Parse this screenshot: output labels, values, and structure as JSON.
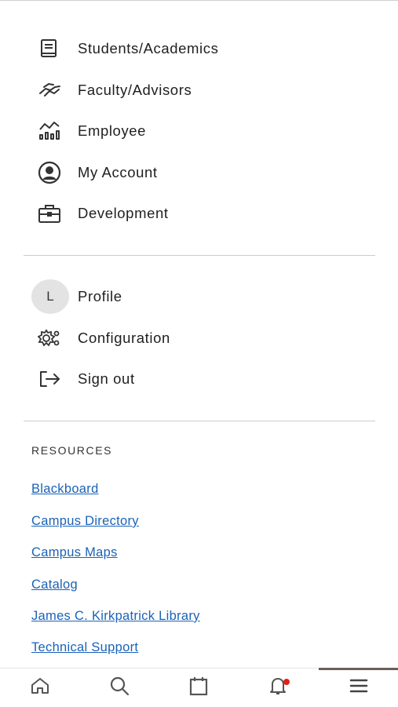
{
  "menu": {
    "items": [
      {
        "label": "Students/Academics",
        "icon": "book-icon"
      },
      {
        "label": "Faculty/Advisors",
        "icon": "handshake-icon"
      },
      {
        "label": "Employee",
        "icon": "chart-icon"
      },
      {
        "label": "My Account",
        "icon": "account-circle-icon"
      },
      {
        "label": "Development",
        "icon": "briefcase-icon"
      }
    ]
  },
  "account": {
    "avatar_initial": "L",
    "profile_label": "Profile",
    "configuration_label": "Configuration",
    "signout_label": "Sign out"
  },
  "resources": {
    "heading": "RESOURCES",
    "links": [
      "Blackboard",
      "Campus Directory",
      "Campus Maps",
      "Catalog",
      "James C. Kirkpatrick Library",
      "Technical Support"
    ]
  },
  "bottom_nav": {
    "items": [
      "home-icon",
      "search-icon",
      "calendar-icon",
      "bell-icon",
      "menu-icon"
    ],
    "active": "menu-icon",
    "notification_color": "#e0201b",
    "link_color": "#1a62b7"
  }
}
